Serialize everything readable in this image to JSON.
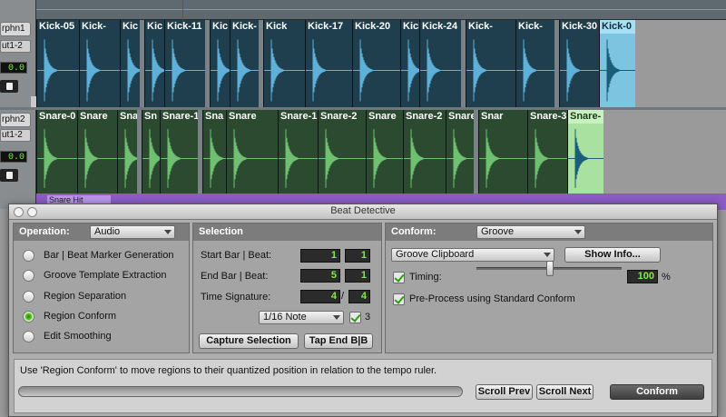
{
  "tracks": [
    {
      "name": "rphn1",
      "output": "ut1-2",
      "volume": "0.0"
    },
    {
      "name": "rphn2",
      "output": "ut1-2",
      "volume": "0.0"
    }
  ],
  "kick_regions": [
    "Kick-05",
    "Kick-",
    "Kic",
    "Kic",
    "Kick-11",
    "Kic",
    "Kick-",
    "Kick",
    "Kick-17",
    "Kick-20",
    "Kick-",
    "Kick-24",
    "Kick-",
    "Kick-",
    "Kick-30",
    "Kick-0"
  ],
  "snare_regions": [
    "Snare-0",
    "Snare",
    "Sna",
    "Sn",
    "Snare-1",
    "Sna",
    "Snare",
    "Snare-1",
    "Snare-2",
    "Snare",
    "Snare-2",
    "Snare",
    "Snar",
    "Snare-3",
    "Snare-"
  ],
  "purple_region": "Snare Hit",
  "dialog": {
    "title": "Beat Detective",
    "operation": {
      "header": "Operation:",
      "mode": "Audio",
      "options": [
        {
          "label": "Bar | Beat Marker Generation",
          "selected": false
        },
        {
          "label": "Groove Template Extraction",
          "selected": false
        },
        {
          "label": "Region Separation",
          "selected": false
        },
        {
          "label": "Region Conform",
          "selected": true
        },
        {
          "label": "Edit Smoothing",
          "selected": false
        }
      ]
    },
    "selection": {
      "header": "Selection",
      "start_label": "Start Bar | Beat:",
      "start_bar": "1",
      "start_beat": "1",
      "end_label": "End Bar | Beat:",
      "end_bar": "5",
      "end_beat": "1",
      "sig_label": "Time Signature:",
      "sig_num": "4",
      "sig_sep": "/",
      "sig_den": "4",
      "note_value": "1/16 Note",
      "triplet_checked": true,
      "triplet_value": "3",
      "capture_button": "Capture Selection",
      "tap_button": "Tap End B|B"
    },
    "conform": {
      "header": "Conform:",
      "mode": "Groove",
      "clipboard": "Groove Clipboard",
      "show_info_button": "Show Info...",
      "timing_checked": true,
      "timing_label": "Timing:",
      "timing_value": "100",
      "timing_unit": "%",
      "timing_level": 0.5,
      "preprocess_checked": true,
      "preprocess_label": "Pre-Process using Standard Conform"
    },
    "status_text": "Use 'Region Conform' to move regions to their quantized position in relation to the tempo ruler.",
    "scroll_prev_button": "Scroll Prev",
    "scroll_next_button": "Scroll Next",
    "conform_button": "Conform"
  },
  "colors": {
    "kick_region": "#1f3f4e",
    "kick_wave": "#5fb0d8",
    "snare_region": "#2b4a30",
    "snare_wave": "#6fc070",
    "counter_text": "#7cf040"
  }
}
